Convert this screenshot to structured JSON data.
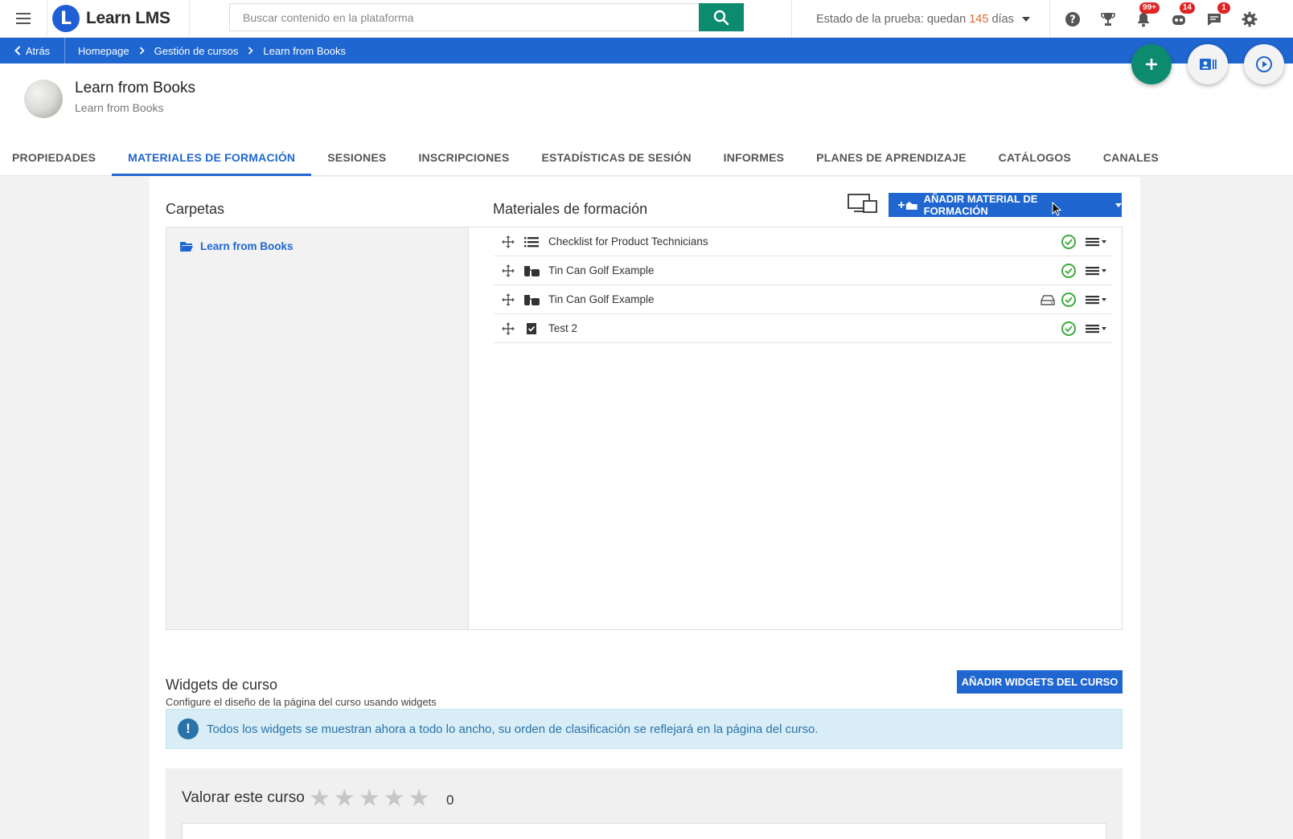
{
  "app": {
    "name": "Learn LMS",
    "logo_letter": "L"
  },
  "search": {
    "placeholder": "Buscar contenido en la plataforma"
  },
  "trial": {
    "prefix": "Estado de la prueba: quedan",
    "days": "145",
    "suffix": "días"
  },
  "notifications": {
    "alerts_badge": "99+",
    "messages_badge": "14",
    "chat_badge": "1"
  },
  "breadcrumb": {
    "back_label": "Atrás",
    "items": [
      "Homepage",
      "Gestión de cursos",
      "Learn from Books"
    ]
  },
  "course": {
    "title": "Learn from Books",
    "subtitle": "Learn from Books"
  },
  "tabs": [
    {
      "label": "PROPIEDADES"
    },
    {
      "label": "MATERIALES DE FORMACIÓN",
      "active": true
    },
    {
      "label": "SESIONES"
    },
    {
      "label": "INSCRIPCIONES"
    },
    {
      "label": "ESTADÍSTICAS DE SESIÓN"
    },
    {
      "label": "INFORMES"
    },
    {
      "label": "PLANES DE APRENDIZAJE"
    },
    {
      "label": "CATÁLOGOS"
    },
    {
      "label": "CANALES"
    }
  ],
  "folders": {
    "title": "Carpetas",
    "items": [
      {
        "label": "Learn from Books"
      }
    ]
  },
  "materials": {
    "title": "Materiales de formación",
    "add_button": "AÑADIR MATERIAL DE FORMACIÓN",
    "items": [
      {
        "name": "Checklist for Product Technicians",
        "type_icon": "checklist-icon",
        "offline": false
      },
      {
        "name": "Tin Can Golf Example",
        "type_icon": "tincan-icon",
        "offline": false
      },
      {
        "name": "Tin Can Golf Example",
        "type_icon": "tincan-icon",
        "offline": true
      },
      {
        "name": "Test 2",
        "type_icon": "test-icon",
        "offline": false
      }
    ]
  },
  "widgets": {
    "title": "Widgets de curso",
    "subtitle": "Configure el diseño de la página del curso usando widgets",
    "add_button": "AÑADIR WIDGETS DEL CURSO",
    "info": "Todos los widgets se muestran ahora a todo lo ancho, su orden de clasificación se reflejará en la página del curso."
  },
  "rating": {
    "label": "Valorar este curso",
    "stars": 5,
    "value": 0,
    "count": "0"
  },
  "colors": {
    "primary": "#1f66d1",
    "accent_green": "#0d8b6f",
    "badge_red": "#e02424",
    "success": "#3caa3c",
    "info_bg": "#d9edf7"
  }
}
